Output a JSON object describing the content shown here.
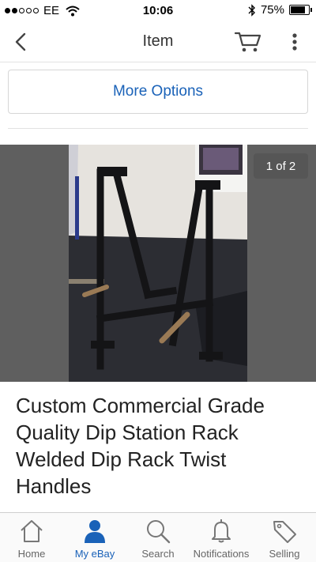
{
  "status_bar": {
    "carrier": "EE",
    "time": "10:06",
    "battery": "75%",
    "battery_level": 0.75
  },
  "nav": {
    "title": "Item",
    "icons": [
      "back-icon",
      "cart-icon",
      "more-vertical-icon"
    ]
  },
  "actions": {
    "more_options_label": "More Options"
  },
  "gallery": {
    "counter": "1 of 2"
  },
  "item": {
    "title": "Custom Commercial Grade Quality Dip Station Rack Welded Dip Rack Twist Handles"
  },
  "tab_bar": {
    "tabs": [
      {
        "label": "Home",
        "icon": "home-icon"
      },
      {
        "label": "My eBay",
        "icon": "user-icon",
        "active": true
      },
      {
        "label": "Search",
        "icon": "search-icon"
      },
      {
        "label": "Notifications",
        "icon": "bell-icon"
      },
      {
        "label": "Selling",
        "icon": "tag-icon"
      }
    ]
  },
  "colors": {
    "accent": "#1a62b8",
    "tab_inactive": "#666666",
    "image_background": "#5f5f5f"
  }
}
